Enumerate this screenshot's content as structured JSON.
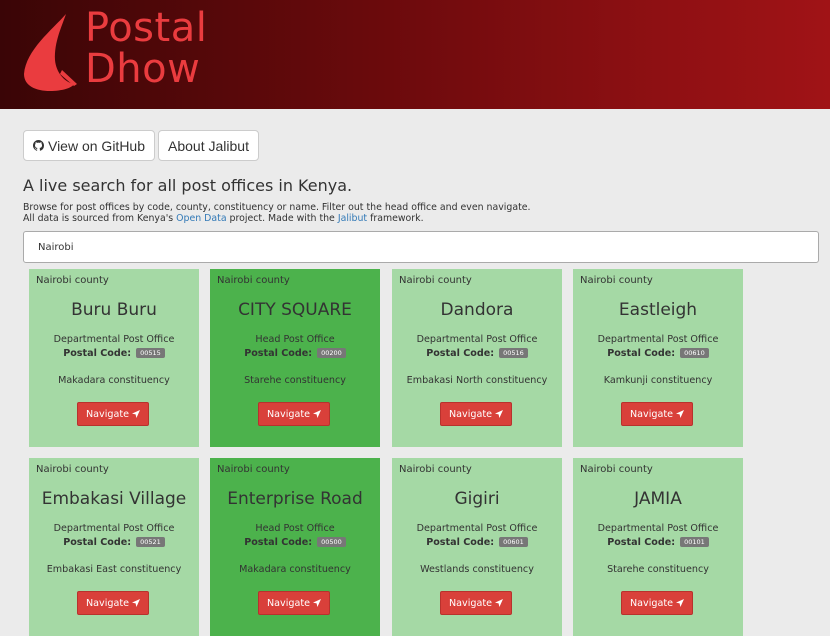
{
  "app": {
    "name_line1": "Postal",
    "name_line2": "Dhow",
    "logo_icon": "dhow-sail-icon"
  },
  "toolbar": {
    "github_label": "View on GitHub",
    "about_label": "About Jalibut"
  },
  "intro": {
    "headline": "A live search for all post offices in Kenya.",
    "line1": "Browse for post offices by code, county, constituency or name. Filter out the head office and even navigate.",
    "line2_prefix": "All data is sourced from Kenya's ",
    "open_data_link": "Open Data",
    "line2_mid": " project. Made with the ",
    "jalibut_link": "Jalibut",
    "line2_suffix": " framework."
  },
  "search": {
    "value": "Nairobi"
  },
  "labels": {
    "postal_code": "Postal Code:",
    "navigate": "Navigate"
  },
  "colors": {
    "header_dark": "#3a0506",
    "header_light": "#a01316",
    "logo_red": "#ea3c3f",
    "card_branch": "#a5d9a5",
    "card_head": "#4cb24c",
    "navigate_button": "#d9403a",
    "link": "#337ab7"
  },
  "offices": [
    {
      "county": "Nairobi county",
      "name": "Buru Buru",
      "type": "Departmental Post Office",
      "code": "00515",
      "constituency": "Makadara constituency",
      "head_office": false
    },
    {
      "county": "Nairobi county",
      "name": "CITY SQUARE",
      "type": "Head Post Office",
      "code": "00200",
      "constituency": "Starehe constituency",
      "head_office": true
    },
    {
      "county": "Nairobi county",
      "name": "Dandora",
      "type": "Departmental Post Office",
      "code": "00516",
      "constituency": "Embakasi North constituency",
      "head_office": false
    },
    {
      "county": "Nairobi county",
      "name": "Eastleigh",
      "type": "Departmental Post Office",
      "code": "00610",
      "constituency": "Kamkunji constituency",
      "head_office": false
    },
    {
      "county": "Nairobi county",
      "name": "Embakasi Village",
      "type": "Departmental Post Office",
      "code": "00521",
      "constituency": "Embakasi East constituency",
      "head_office": false
    },
    {
      "county": "Nairobi county",
      "name": "Enterprise Road",
      "type": "Head Post Office",
      "code": "00500",
      "constituency": "Makadara constituency",
      "head_office": true
    },
    {
      "county": "Nairobi county",
      "name": "Gigiri",
      "type": "Departmental Post Office",
      "code": "00601",
      "constituency": "Westlands constituency",
      "head_office": false
    },
    {
      "county": "Nairobi county",
      "name": "JAMIA",
      "type": "Departmental Post Office",
      "code": "00101",
      "constituency": "Starehe constituency",
      "head_office": false
    }
  ]
}
